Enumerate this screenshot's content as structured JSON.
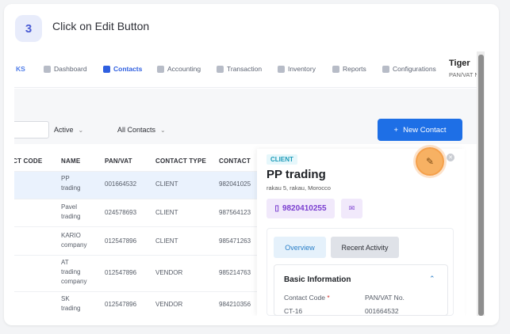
{
  "step": {
    "number": "3",
    "title": "Click on Edit Button"
  },
  "nav": {
    "brand_fragment": "KS",
    "items": [
      {
        "label": "Dashboard",
        "icon": "grid-icon",
        "active": false
      },
      {
        "label": "Contacts",
        "icon": "contacts-icon",
        "active": true
      },
      {
        "label": "Accounting",
        "icon": "cube-icon",
        "active": false
      },
      {
        "label": "Transaction",
        "icon": "transfer-icon",
        "active": false
      },
      {
        "label": "Inventory",
        "icon": "box-icon",
        "active": false
      },
      {
        "label": "Reports",
        "icon": "reports-icon",
        "active": false
      },
      {
        "label": "Configurations",
        "icon": "gear-icon",
        "active": false
      }
    ],
    "user_name": "Tiger",
    "user_sub": "PAN/VAT No."
  },
  "filters": {
    "status": "Active",
    "contacts": "All Contacts"
  },
  "new_contact_label": "New Contact",
  "table": {
    "headers": [
      "CT CODE",
      "NAME",
      "PAN/VAT",
      "CONTACT TYPE",
      "CONTACT"
    ],
    "rows": [
      {
        "name": [
          "PP",
          "trading"
        ],
        "pan": "001664532",
        "type": "CLIENT",
        "contact": "982041025"
      },
      {
        "name": [
          "Pavel",
          "trading"
        ],
        "pan": "024578693",
        "type": "CLIENT",
        "contact": "987564123"
      },
      {
        "name": [
          "KARIO",
          "company"
        ],
        "pan": "012547896",
        "type": "CLIENT",
        "contact": "985471263"
      },
      {
        "name": [
          "AT",
          "trading",
          "company"
        ],
        "pan": "012547896",
        "type": "VENDOR",
        "contact": "985214763"
      },
      {
        "name": [
          "SK",
          "trading"
        ],
        "pan": "012547896",
        "type": "VENDOR",
        "contact": "984210356"
      }
    ]
  },
  "detail": {
    "tag": "CLIENT",
    "title": "PP trading",
    "address": "rakau 5, rakau, Morocco",
    "phone": "9820410255",
    "tabs": [
      "Overview",
      "Recent Activity"
    ],
    "section_title": "Basic Information",
    "contact_code_label": "Contact Code",
    "contact_code_value": "CT-16",
    "pan_label": "PAN/VAT No.",
    "pan_value": "001664532"
  },
  "colors": {
    "accent": "#1e6fe6",
    "highlight": "#f5a04a",
    "client_tag": "#1b9ab8",
    "phone": "#7b3fd0"
  }
}
